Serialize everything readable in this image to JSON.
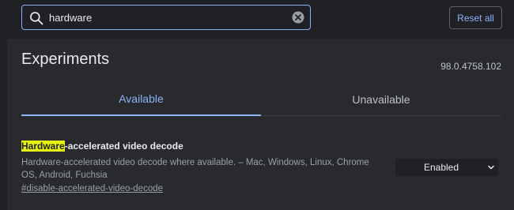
{
  "search": {
    "value": "hardware",
    "icon": "search-icon",
    "clear_icon": "clear-icon"
  },
  "header": {
    "reset_label": "Reset all"
  },
  "page": {
    "title": "Experiments",
    "version": "98.0.4758.102"
  },
  "tabs": [
    {
      "label": "Available",
      "active": true
    },
    {
      "label": "Unavailable",
      "active": false
    }
  ],
  "experiment": {
    "title_highlight": "Hardware",
    "title_rest": "-accelerated video decode",
    "description": "Hardware-accelerated video decode where available. – Mac, Windows, Linux, Chrome OS, Android, Fuchsia",
    "link": "#disable-accelerated-video-decode",
    "state": "Enabled"
  },
  "colors": {
    "accent": "#8ab4f8",
    "highlight": "#e5f30e",
    "background": "#202124",
    "panel": "#292a2d"
  }
}
